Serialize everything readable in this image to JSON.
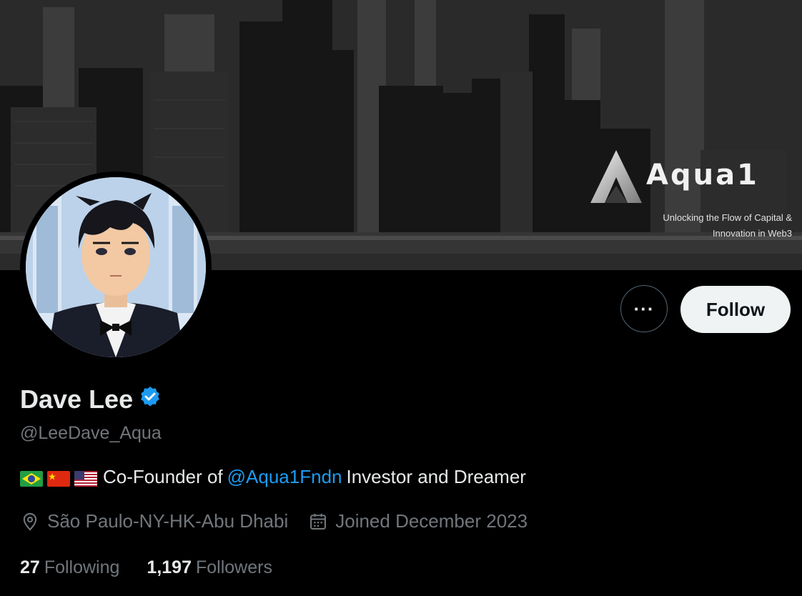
{
  "banner": {
    "logo_name": "Aqua1",
    "logo_tagline_line1": "Unlocking the Flow of Capital &",
    "logo_tagline_line2": "Innovation in Web3"
  },
  "actions": {
    "more_label": "···",
    "follow_label": "Follow"
  },
  "profile": {
    "display_name": "Dave Lee",
    "handle": "@LeeDave_Aqua",
    "verified": true,
    "bio": {
      "flags": [
        "flag-brazil-icon",
        "flag-china-icon",
        "flag-usa-icon"
      ],
      "prefix": "Co-Founder of",
      "mention": "@Aqua1Fndn",
      "suffix": "Investor and Dreamer"
    },
    "location": "São Paulo-NY-HK-Abu Dhabi",
    "joined": "Joined December 2023"
  },
  "stats": {
    "following_count": "27",
    "following_label": "Following",
    "followers_count": "1,197",
    "followers_label": "Followers"
  },
  "colors": {
    "background": "#000000",
    "text_primary": "#e7e9ea",
    "text_secondary": "#71767b",
    "link": "#1d9bf0",
    "follow_bg": "#eff3f4",
    "verified": "#1d9bf0"
  },
  "icons": {
    "verified": "verified-badge-icon",
    "location": "location-pin-icon",
    "calendar": "calendar-icon",
    "more": "more-horizontal-icon"
  }
}
